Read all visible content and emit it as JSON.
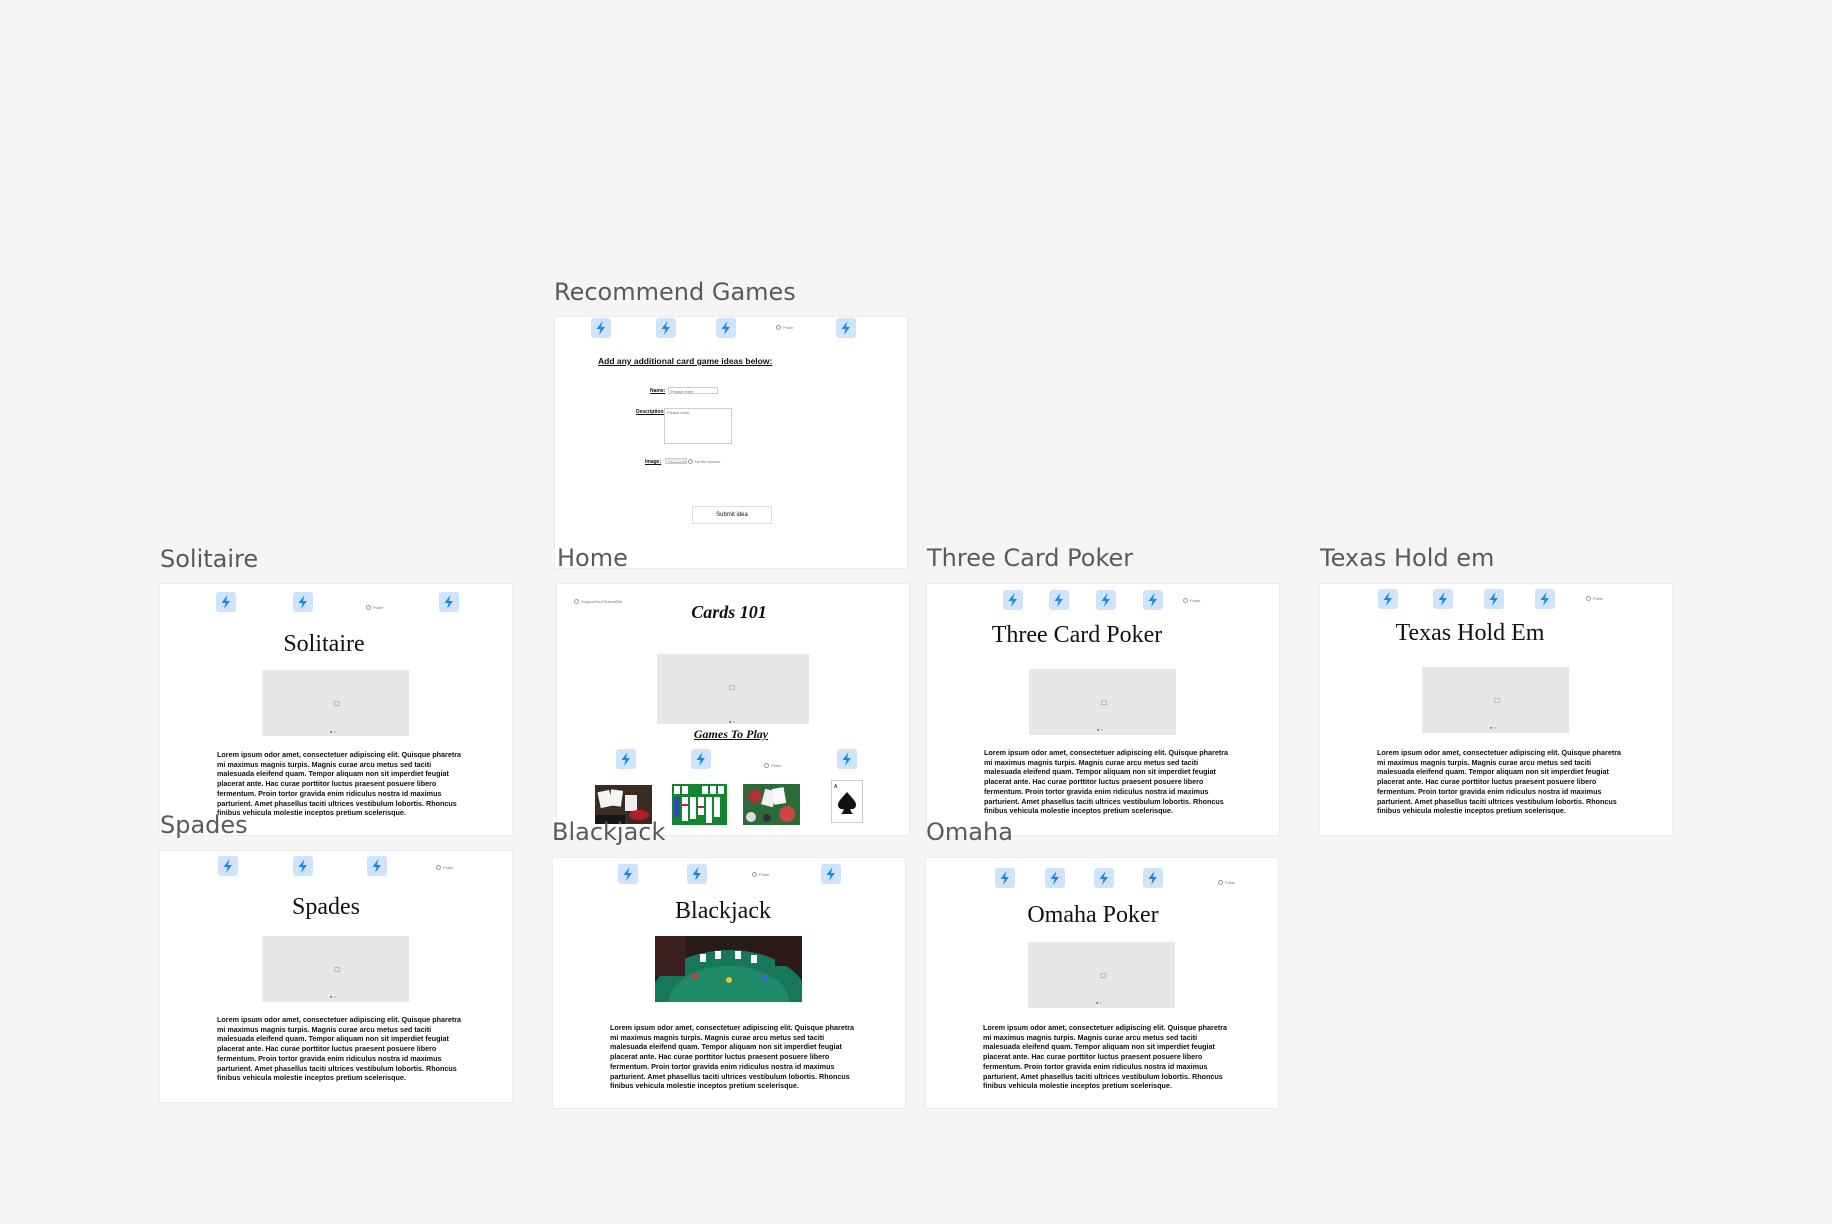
{
  "frames": {
    "recommend": {
      "label": "Recommend Games",
      "heading": "Add any additional card game ideas below:",
      "name_label": "Name:",
      "name_placeholder": "Please enter",
      "description_label": "Description:",
      "description_placeholder": "Please enter",
      "image_label": "Image:",
      "image_button": "Choose File",
      "image_status": "No file chosen",
      "submit_label": "Submit idea",
      "nav_text": "Poker"
    },
    "solitaire": {
      "label": "Solitaire",
      "title": "Solitaire",
      "nav_text": "Poker"
    },
    "home": {
      "label": "Home",
      "title": "Cards 101",
      "games_heading": "Games To Play",
      "logo_text": "SupportYourTextureBar",
      "nav_text": "Poker"
    },
    "three_card": {
      "label": "Three Card Poker",
      "title": "Three Card Poker",
      "nav_text": "Poker"
    },
    "texas": {
      "label": "Texas Hold em",
      "title": "Texas Hold Em",
      "nav_text": "Poker"
    },
    "spades": {
      "label": "Spades",
      "title": "Spades",
      "nav_text": "Poker"
    },
    "blackjack": {
      "label": "Blackjack",
      "title": "Blackjack",
      "nav_text": "Poker"
    },
    "omaha": {
      "label": "Omaha",
      "title": "Omaha Poker",
      "nav_text": "Poker"
    }
  },
  "lorem": "Lorem ipsum odor amet, consectetuer adipiscing elit. Quisque pharetra mi maximus magnis turpis. Magnis curae arcu metus sed taciti malesuada eleifend quam. Tempor aliquam non sit imperdiet feugiat placerat ante. Hac curae porttitor luctus praesent posuere libero fermentum. Proin tortor gravida enim ridiculus nostra id maximus parturient. Amet phasellus taciti ultrices vestibulum lobortis. Rhoncus finibus vehicula molestie inceptos pretium scelerisque.",
  "pager_text": "● ○",
  "colors": {
    "accent": "#1e88e5",
    "icon_bg": "#cfe4fb",
    "placeholder": "#e7e7e7"
  },
  "icons": {
    "nav_icon": "lightning-bolt-icon"
  }
}
